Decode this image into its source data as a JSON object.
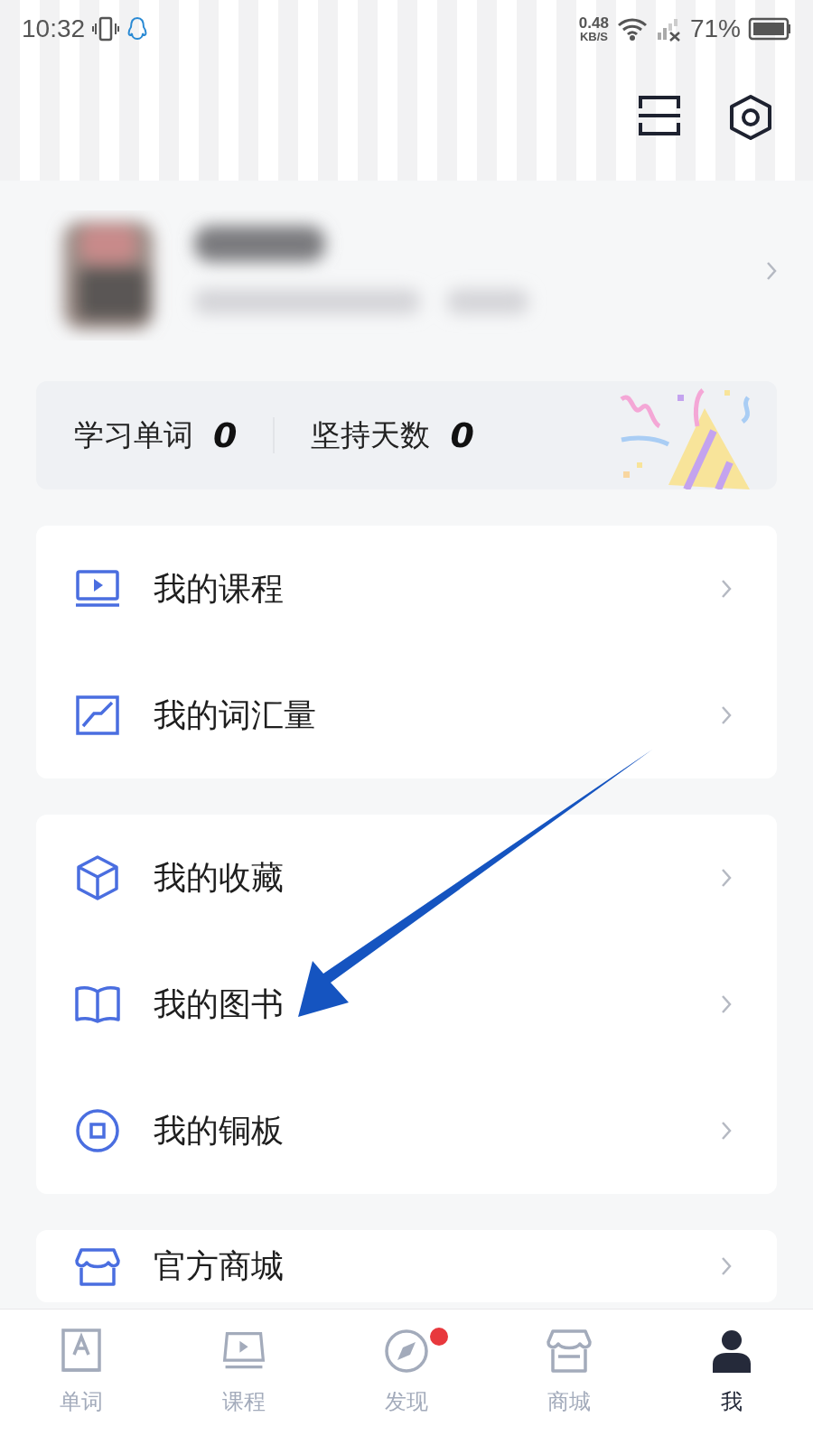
{
  "status_bar": {
    "time": "10:32",
    "speed_value": "0.48",
    "speed_unit": "KB/S",
    "battery": "71%"
  },
  "stats": [
    {
      "label": "学习单词",
      "value": "0"
    },
    {
      "label": "坚持天数",
      "value": "0"
    }
  ],
  "menu_groups": [
    [
      {
        "kind": "course",
        "label": "我的课程"
      },
      {
        "kind": "vocab",
        "label": "我的词汇量"
      }
    ],
    [
      {
        "kind": "favorites",
        "label": "我的收藏"
      },
      {
        "kind": "books",
        "label": "我的图书"
      },
      {
        "kind": "coins",
        "label": "我的铜板"
      }
    ],
    [
      {
        "kind": "shop",
        "label": "官方商城"
      }
    ]
  ],
  "tab_bar": [
    {
      "kind": "words",
      "label": "单词",
      "selected": false,
      "badge": false
    },
    {
      "kind": "course",
      "label": "课程",
      "selected": false,
      "badge": false
    },
    {
      "kind": "discover",
      "label": "发现",
      "selected": false,
      "badge": true
    },
    {
      "kind": "shop",
      "label": "商城",
      "selected": false,
      "badge": false
    },
    {
      "kind": "me",
      "label": "我",
      "selected": true,
      "badge": false
    }
  ]
}
